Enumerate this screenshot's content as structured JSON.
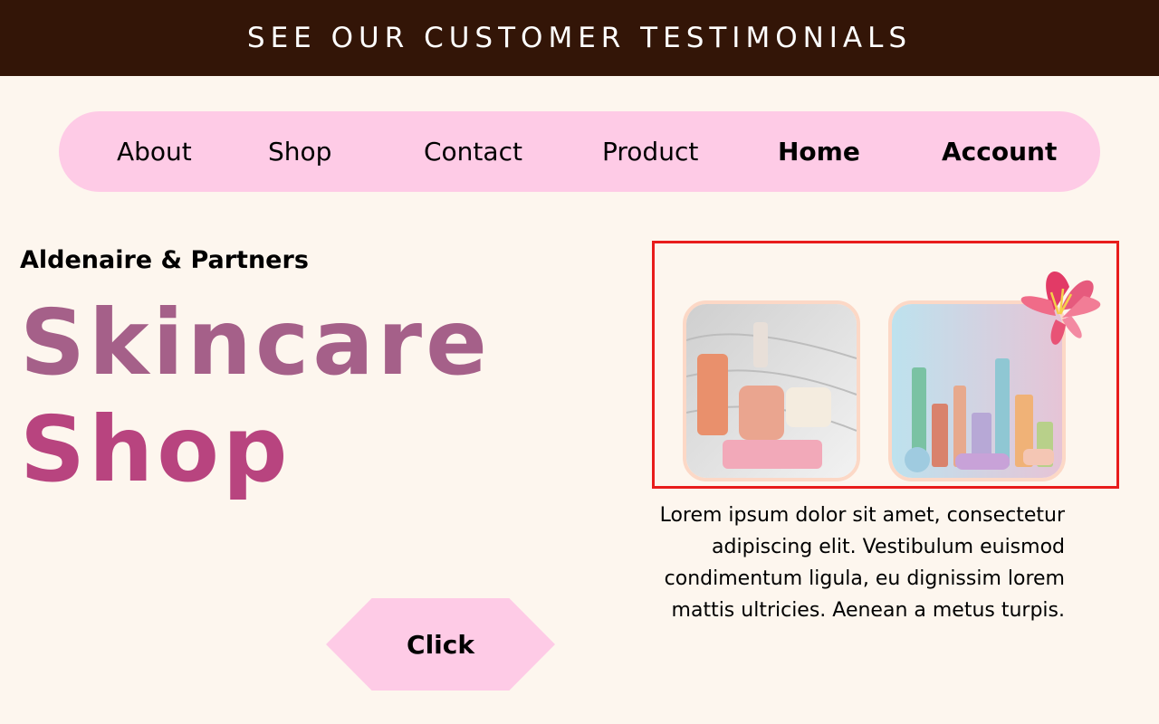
{
  "banner": {
    "text": "SEE OUR CUSTOMER TESTIMONIALS"
  },
  "nav": {
    "items": [
      {
        "label": "About"
      },
      {
        "label": "Shop"
      },
      {
        "label": "Contact"
      },
      {
        "label": "Product"
      },
      {
        "label": "Home"
      },
      {
        "label": "Account"
      }
    ]
  },
  "hero": {
    "brand": "Aldenaire & Partners",
    "title_line1": "Skincare",
    "title_line2": "Shop"
  },
  "cta": {
    "label": "Click"
  },
  "gallery": {
    "images": [
      {
        "name": "skincare-products-photo"
      },
      {
        "name": "cosmetic-bottles-photo"
      }
    ],
    "decoration": "lily-flower-icon"
  },
  "description": {
    "text": "Lorem ipsum dolor sit amet, consectetur adipiscing elit. Vestibulum euismod condimentum ligula, eu dignissim lorem mattis ultricies. Aenean a metus turpis."
  },
  "colors": {
    "banner_bg": "#331507",
    "page_bg": "#fdf6ee",
    "nav_bg": "#fecbe6",
    "hero_line1": "#a56089",
    "hero_line2": "#b8447f",
    "highlight_border": "#e81c1c"
  }
}
